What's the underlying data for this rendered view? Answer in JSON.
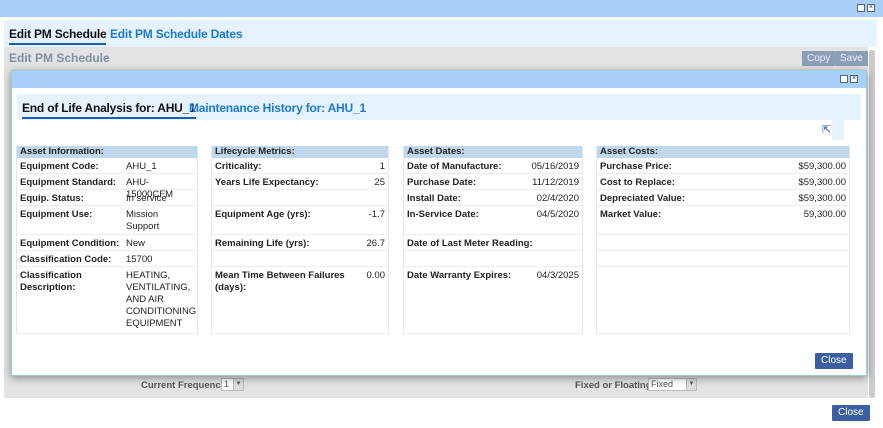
{
  "outer": {
    "tabs": [
      {
        "label": "Edit PM Schedule"
      },
      {
        "label": "Edit PM Schedule Dates"
      }
    ],
    "panel_title": "Edit PM Schedule",
    "copy": "Copy",
    "save": "Save",
    "close": "Close",
    "current_frequency_label": "Current Frequency",
    "current_frequency_value": "1",
    "fixed_label": "Fixed or Floating",
    "fixed_value": "Fixed"
  },
  "modal": {
    "tabs": [
      {
        "label": "End of Life Analysis for: AHU_1"
      },
      {
        "label": "Maintenance History for: AHU_1"
      }
    ],
    "close": "Close",
    "asset_info": {
      "title": "Asset Information:",
      "rows": [
        {
          "label": "Equipment Code:",
          "value": "AHU_1"
        },
        {
          "label": "Equipment Standard:",
          "value": "AHU-15000CFM"
        },
        {
          "label": "Equip. Status:",
          "value": "In service"
        },
        {
          "label": "Equipment Use:",
          "value": "Mission Support"
        },
        {
          "label": "Equipment Condition:",
          "value": "New"
        },
        {
          "label": "Classification Code:",
          "value": "15700"
        },
        {
          "label": "Classification Description:",
          "value": "HEATING, VENTILATING, AND AIR CONDITIONING EQUIPMENT"
        }
      ]
    },
    "lifecycle": {
      "title": "Lifecycle Metrics:",
      "rows": [
        {
          "label": "Criticality:",
          "value": "1"
        },
        {
          "label": "Years Life Expectancy:",
          "value": "25"
        },
        {
          "label": "",
          "value": ""
        },
        {
          "label": "Equipment Age (yrs):",
          "value": "-1.7"
        },
        {
          "label": "Remaining Life (yrs):",
          "value": "26.7"
        },
        {
          "label": "",
          "value": ""
        },
        {
          "label": "Mean Time Between Failures (days):",
          "value": "0.00"
        }
      ]
    },
    "dates": {
      "title": "Asset Dates:",
      "rows": [
        {
          "label": "Date of Manufacture:",
          "value": "05/16/2019"
        },
        {
          "label": "Purchase Date:",
          "value": "11/12/2019"
        },
        {
          "label": "Install Date:",
          "value": "02/4/2020"
        },
        {
          "label": "In-Service Date:",
          "value": "04/5/2020"
        },
        {
          "label": "Date of Last Meter Reading:",
          "value": ""
        },
        {
          "label": "",
          "value": ""
        },
        {
          "label": "Date Warranty Expires:",
          "value": "04/3/2025"
        }
      ]
    },
    "costs": {
      "title": "Asset Costs:",
      "rows": [
        {
          "label": "Purchase Price:",
          "value": "$59,300.00"
        },
        {
          "label": "Cost to Replace:",
          "value": "$59,300.00"
        },
        {
          "label": "Depreciated Value:",
          "value": "$59,300.00"
        },
        {
          "label": "Market Value:",
          "value": "59,300.00"
        },
        {
          "label": "",
          "value": ""
        },
        {
          "label": "",
          "value": ""
        },
        {
          "label": "",
          "value": ""
        }
      ]
    }
  }
}
